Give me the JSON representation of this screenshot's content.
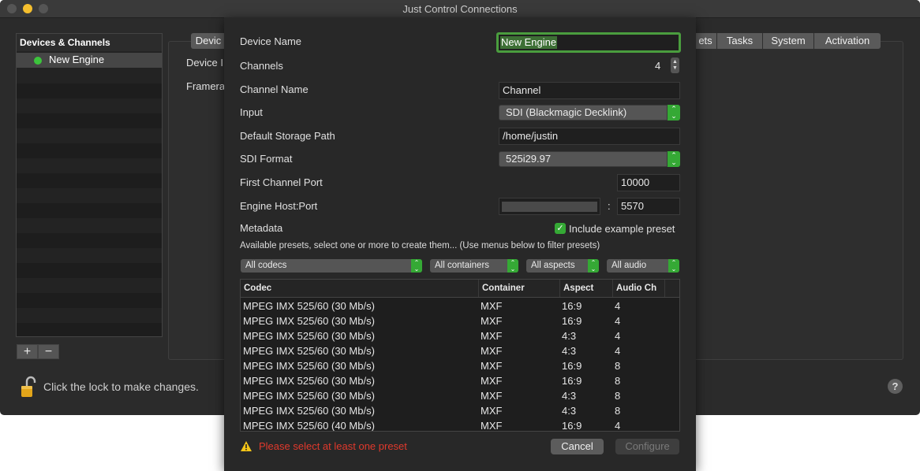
{
  "window": {
    "title": "Just Control Connections"
  },
  "sidebar": {
    "header": "Devices & Channels",
    "items": [
      {
        "label": "New Engine",
        "status_color": "#3cc43c"
      }
    ],
    "add_label": "+",
    "remove_label": "−"
  },
  "background_panel": {
    "tabs_left_partial": "Devic",
    "tabs_right": [
      "ets",
      "Tasks",
      "System",
      "Activation"
    ],
    "labels": [
      "Device I",
      "Framera"
    ]
  },
  "footer": {
    "lock_text": "Click the lock to make changes.",
    "help_label": "?"
  },
  "sheet": {
    "device_name": {
      "label": "Device Name",
      "value": "New Engine"
    },
    "channels": {
      "label": "Channels",
      "value": "4"
    },
    "channel_name": {
      "label": "Channel Name",
      "value": "Channel"
    },
    "input": {
      "label": "Input",
      "value": "SDI (Blackmagic Decklink)"
    },
    "storage_path": {
      "label": "Default Storage Path",
      "value": "/home/justin"
    },
    "sdi_format": {
      "label": "SDI Format",
      "value": "525i29.97"
    },
    "first_port": {
      "label": "First Channel Port",
      "value": "10000"
    },
    "engine_host": {
      "label": "Engine Host:Port",
      "host": "",
      "separator": ":",
      "port": "5570"
    },
    "metadata": {
      "label": "Metadata",
      "checkbox_label": "Include example preset",
      "checked": true
    },
    "presets_hint": "Available presets, select one or more to create them... (Use menus below to filter presets)",
    "filters": [
      "All codecs",
      "All containers",
      "All aspects",
      "All audio"
    ],
    "table": {
      "columns": [
        "Codec",
        "Container",
        "Aspect",
        "Audio Ch"
      ],
      "rows": [
        [
          "MPEG IMX 525/60 (30 Mb/s)",
          "MXF",
          "16:9",
          "4"
        ],
        [
          "MPEG IMX 525/60 (30 Mb/s)",
          "MXF",
          "16:9",
          "4"
        ],
        [
          "MPEG IMX 525/60 (30 Mb/s)",
          "MXF",
          "4:3",
          "4"
        ],
        [
          "MPEG IMX 525/60 (30 Mb/s)",
          "MXF",
          "4:3",
          "4"
        ],
        [
          "MPEG IMX 525/60 (30 Mb/s)",
          "MXF",
          "16:9",
          "8"
        ],
        [
          "MPEG IMX 525/60 (30 Mb/s)",
          "MXF",
          "16:9",
          "8"
        ],
        [
          "MPEG IMX 525/60 (30 Mb/s)",
          "MXF",
          "4:3",
          "8"
        ],
        [
          "MPEG IMX 525/60 (30 Mb/s)",
          "MXF",
          "4:3",
          "8"
        ],
        [
          "MPEG IMX 525/60 (40 Mb/s)",
          "MXF",
          "16:9",
          "4"
        ]
      ]
    },
    "warning": {
      "text": "Please select at least one preset",
      "color": "#e0392c"
    },
    "cancel_label": "Cancel",
    "configure_label": "Configure"
  }
}
